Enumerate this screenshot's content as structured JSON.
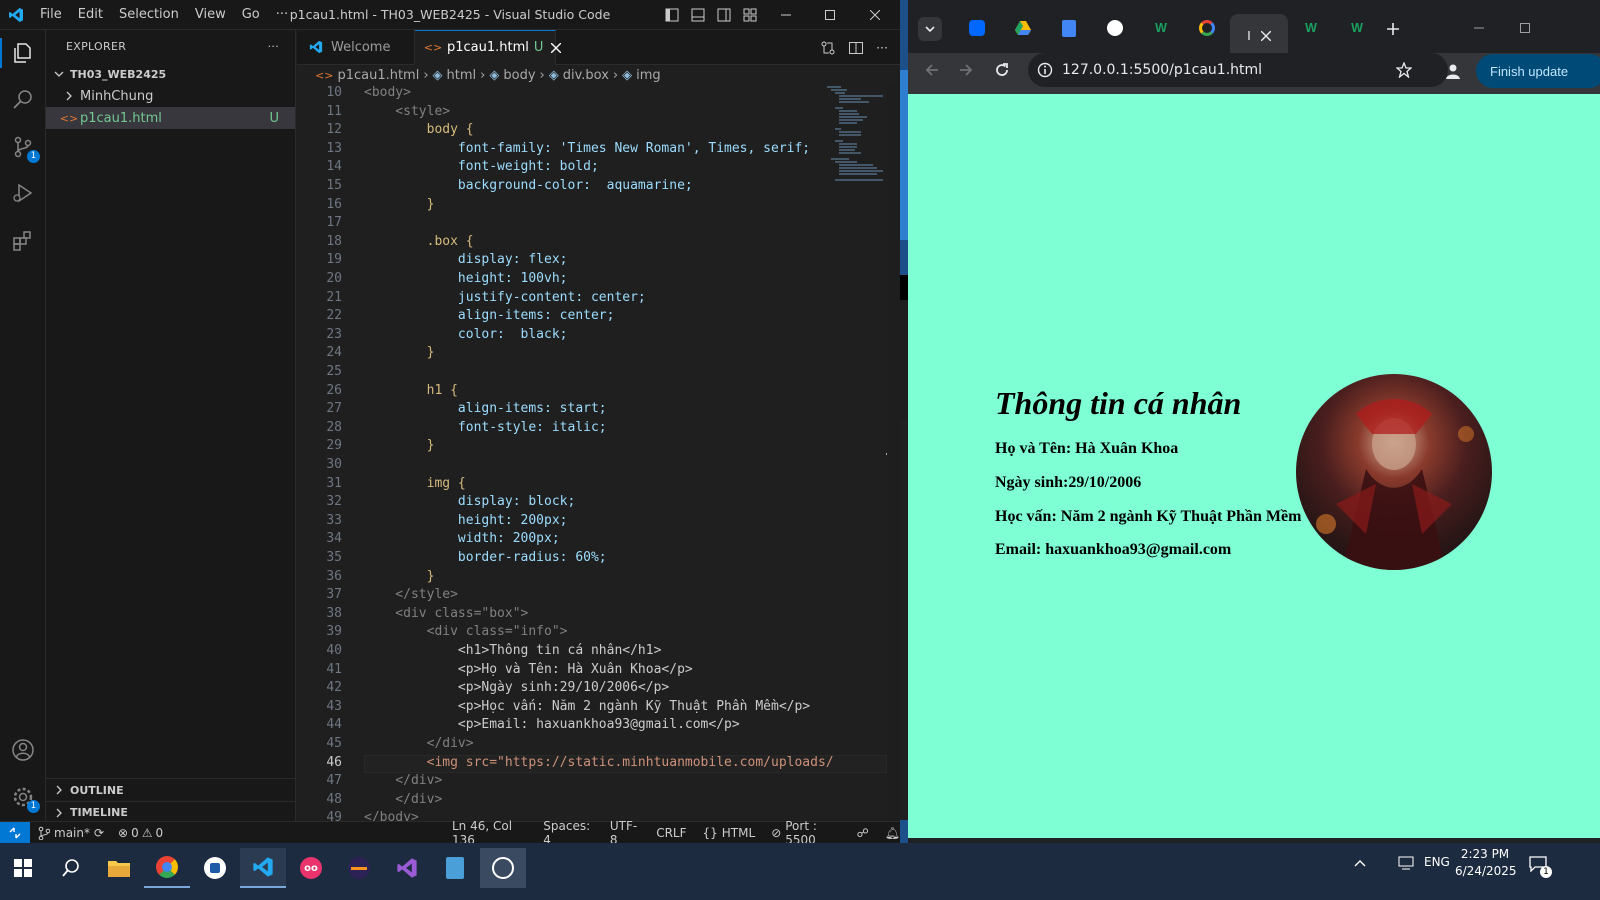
{
  "vscode": {
    "window_title": "p1cau1.html - TH03_WEB2425 - Visual Studio Code",
    "menu": [
      "File",
      "Edit",
      "Selection",
      "View",
      "Go",
      "···"
    ],
    "explorer": {
      "header": "EXPLORER",
      "more": "···",
      "root": "TH03_WEB2425",
      "items": [
        {
          "name": "MinhChung",
          "kind": "folder",
          "status": ""
        },
        {
          "name": "p1cau1.html",
          "kind": "file",
          "status": "U"
        }
      ],
      "outline": "OUTLINE",
      "timeline": "TIMELINE"
    },
    "activity_badges": {
      "scm": "1",
      "settings": "1"
    },
    "tabs": [
      {
        "label": "Welcome",
        "active": false,
        "status": ""
      },
      {
        "label": "p1cau1.html",
        "active": true,
        "status": "U"
      }
    ],
    "breadcrumb": [
      "p1cau1.html",
      "html",
      "body",
      "div.box",
      "img"
    ],
    "code": [
      {
        "n": "10",
        "t": "<body>"
      },
      {
        "n": "11",
        "t": "    <style>"
      },
      {
        "n": "12",
        "t": "        body {"
      },
      {
        "n": "13",
        "t": "            font-family: 'Times New Roman', Times, serif;"
      },
      {
        "n": "14",
        "t": "            font-weight: bold;"
      },
      {
        "n": "15",
        "t": "            background-color:  aquamarine;"
      },
      {
        "n": "16",
        "t": "        }"
      },
      {
        "n": "17",
        "t": ""
      },
      {
        "n": "18",
        "t": "        .box {"
      },
      {
        "n": "19",
        "t": "            display: flex;"
      },
      {
        "n": "20",
        "t": "            height: 100vh;"
      },
      {
        "n": "21",
        "t": "            justify-content: center;"
      },
      {
        "n": "22",
        "t": "            align-items: center;"
      },
      {
        "n": "23",
        "t": "            color:  black;"
      },
      {
        "n": "24",
        "t": "        }"
      },
      {
        "n": "25",
        "t": ""
      },
      {
        "n": "26",
        "t": "        h1 {"
      },
      {
        "n": "27",
        "t": "            align-items: start;"
      },
      {
        "n": "28",
        "t": "            font-style: italic;"
      },
      {
        "n": "29",
        "t": "        }"
      },
      {
        "n": "30",
        "t": ""
      },
      {
        "n": "31",
        "t": "        img {"
      },
      {
        "n": "32",
        "t": "            display: block;"
      },
      {
        "n": "33",
        "t": "            height: 200px;"
      },
      {
        "n": "34",
        "t": "            width: 200px;"
      },
      {
        "n": "35",
        "t": "            border-radius: 60%;"
      },
      {
        "n": "36",
        "t": "        }"
      },
      {
        "n": "37",
        "t": "    </style>"
      },
      {
        "n": "38",
        "t": "    <div class=\"box\">"
      },
      {
        "n": "39",
        "t": "        <div class=\"info\">"
      },
      {
        "n": "40",
        "t": "            <h1>Thông tin cá nhân</h1>"
      },
      {
        "n": "41",
        "t": "            <p>Họ và Tên: Hà Xuân Khoa</p>"
      },
      {
        "n": "42",
        "t": "            <p>Ngày sinh:29/10/2006</p>"
      },
      {
        "n": "43",
        "t": "            <p>Học vấn: Năm 2 ngành Kỹ Thuật Phần Mềm</p>"
      },
      {
        "n": "44",
        "t": "            <p>Email: haxuankhoa93@gmail.com</p>"
      },
      {
        "n": "45",
        "t": "        </div>"
      },
      {
        "n": "46",
        "t": "        <img src=\"https://static.minhtuanmobile.com/uploads/"
      },
      {
        "n": "47",
        "t": "    </div>"
      },
      {
        "n": "48",
        "t": "    </div>"
      },
      {
        "n": "49",
        "t": "</body>"
      }
    ],
    "active_line": "46",
    "status": {
      "branch": "main*",
      "errors": "0",
      "warnings": "0",
      "position": "Ln 46, Col 136",
      "spaces": "Spaces: 4",
      "encoding": "UTF-8",
      "eol": "CRLF",
      "language": "HTML",
      "port": "Port : 5500"
    }
  },
  "browser": {
    "url": "127.0.0.1:5500/p1cau1.html",
    "finish_update": "Finish update",
    "page": {
      "title": "Thông tin cá nhân",
      "lines": [
        "Họ và Tên: Hà Xuân Khoa",
        "Ngày sinh:29/10/2006",
        "Học vấn: Năm 2 ngành Kỹ Thuật Phần Mềm",
        "Email: haxuankhoa93@gmail.com"
      ],
      "background": "#7fffd4"
    }
  },
  "taskbar": {
    "language": "ENG",
    "time": "2:23 PM",
    "date": "6/24/2025",
    "notifications": "1"
  }
}
